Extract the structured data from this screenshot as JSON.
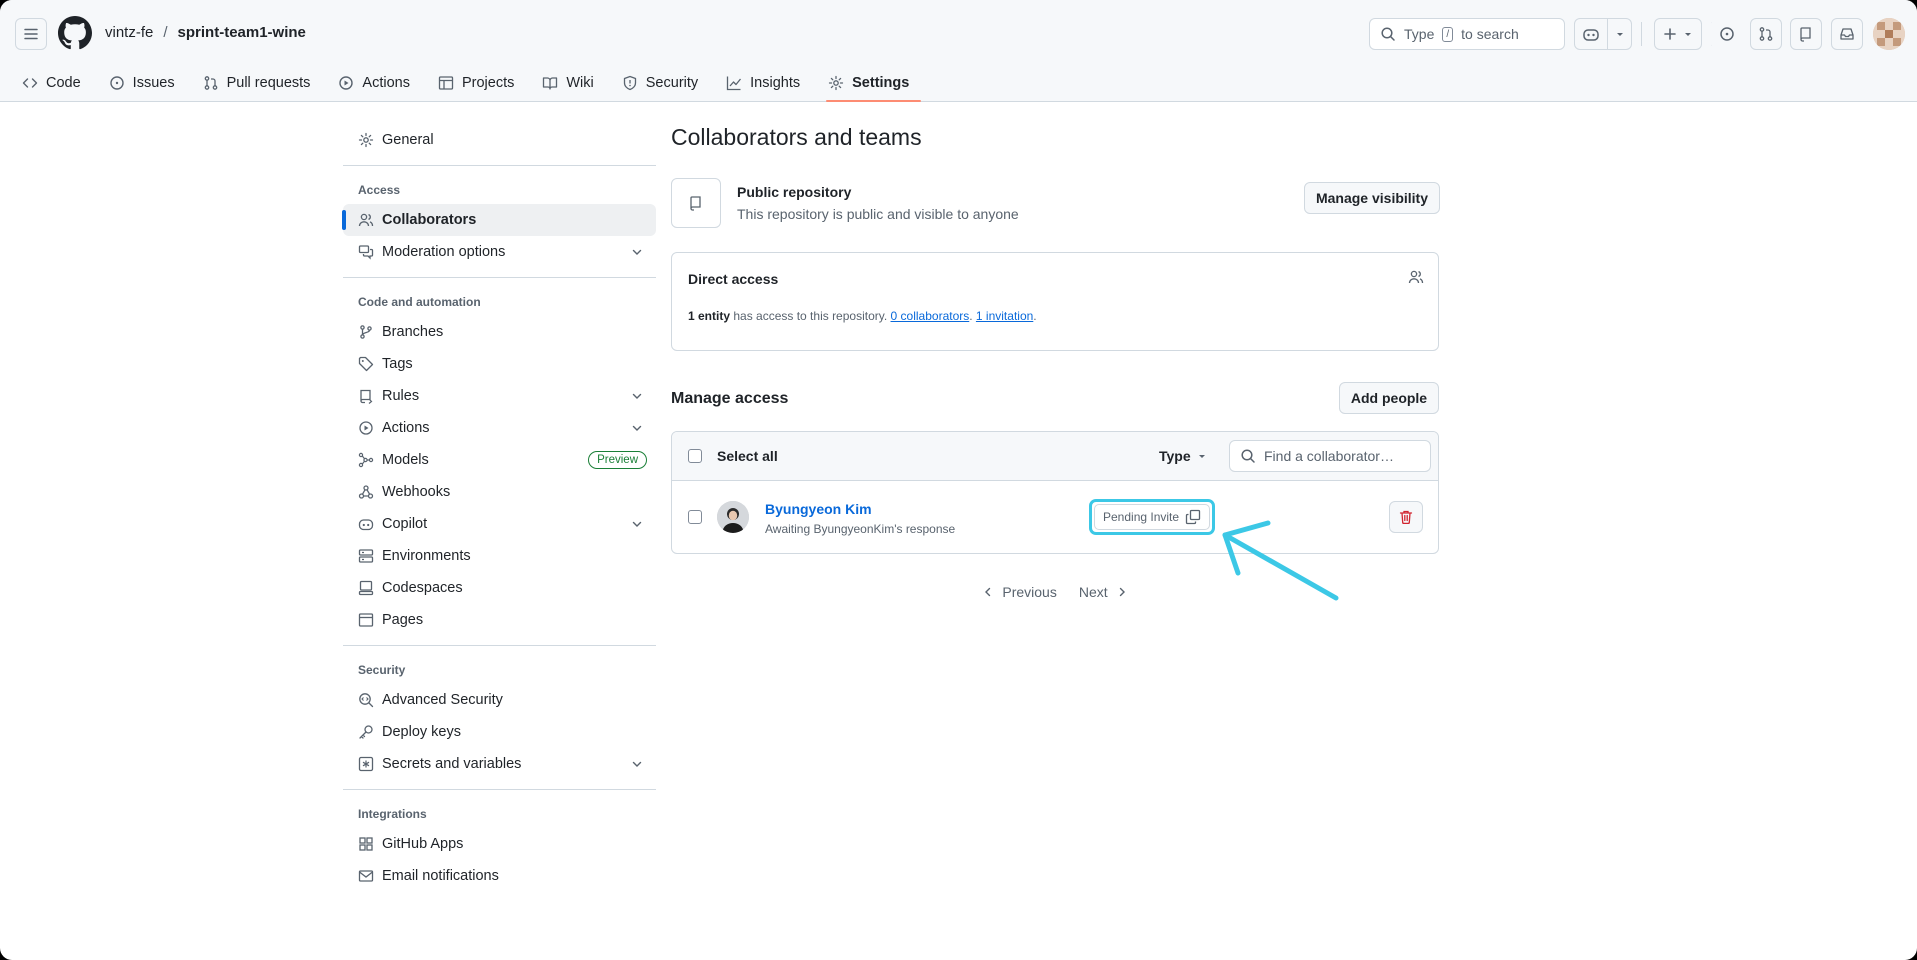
{
  "breadcrumb": {
    "owner": "vintz-fe",
    "separator": "/",
    "repo": "sprint-team1-wine"
  },
  "search": {
    "prefix": "Type",
    "key": "/",
    "suffix": "to search"
  },
  "repo_nav": [
    {
      "label": "Code",
      "icon": "code-icon"
    },
    {
      "label": "Issues",
      "icon": "issue-icon"
    },
    {
      "label": "Pull requests",
      "icon": "pull-request-icon"
    },
    {
      "label": "Actions",
      "icon": "play-icon"
    },
    {
      "label": "Projects",
      "icon": "table-icon"
    },
    {
      "label": "Wiki",
      "icon": "book-icon"
    },
    {
      "label": "Security",
      "icon": "shield-icon"
    },
    {
      "label": "Insights",
      "icon": "graph-icon"
    },
    {
      "label": "Settings",
      "icon": "gear-icon",
      "active": true
    }
  ],
  "sidebar": {
    "general": "General",
    "access_heading": "Access",
    "collaborators": "Collaborators",
    "moderation": "Moderation options",
    "code_heading": "Code and automation",
    "branches": "Branches",
    "tags": "Tags",
    "rules": "Rules",
    "actions": "Actions",
    "models": "Models",
    "models_badge": "Preview",
    "webhooks": "Webhooks",
    "copilot": "Copilot",
    "environments": "Environments",
    "codespaces": "Codespaces",
    "pages": "Pages",
    "security_heading": "Security",
    "advanced_security": "Advanced Security",
    "deploy_keys": "Deploy keys",
    "secrets": "Secrets and variables",
    "integrations_heading": "Integrations",
    "github_apps": "GitHub Apps",
    "email_notifications": "Email notifications"
  },
  "main": {
    "title": "Collaborators and teams",
    "public_title": "Public repository",
    "public_desc": "This repository is public and visible to anyone",
    "manage_visibility": "Manage visibility",
    "direct_access_title": "Direct access",
    "direct_entity": "1 entity",
    "direct_text": " has access to this repository. ",
    "direct_collaborators": "0 collaborators",
    "direct_invitation": "1 invitation",
    "manage_access_title": "Manage access",
    "add_people": "Add people",
    "select_all": "Select all",
    "type_filter": "Type",
    "find_placeholder": "Find a collaborator…",
    "collaborator": {
      "name": "Byungyeon Kim",
      "status": "Awaiting ByungyeonKim's response",
      "badge": "Pending Invite"
    },
    "previous": "Previous",
    "next": "Next"
  },
  "colors": {
    "accent": "#0969da",
    "highlight": "#3cc8e6",
    "danger": "#d1242f",
    "settings_underline": "#fd8c73"
  }
}
